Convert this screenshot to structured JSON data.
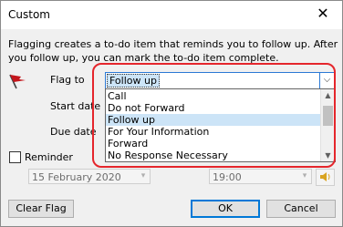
{
  "window": {
    "title": "Custom",
    "close_label": "✕"
  },
  "description": "Flagging creates a to-do item that reminds you to follow up. After you follow up, you can mark the to-do item complete.",
  "form": {
    "flag_to_label": "Flag to",
    "start_date_label": "Start date",
    "due_date_label": "Due date",
    "reminder_label": "Reminder",
    "reminder_checked": false
  },
  "flag_combo": {
    "selected_value": "Follow up",
    "arrow": "⌵",
    "options": [
      "Call",
      "Do not Forward",
      "Follow up",
      "For Your Information",
      "Forward",
      "No Response Necessary"
    ],
    "selected_index": 2
  },
  "reminder": {
    "date_value": "15 February 2020",
    "time_value": "19:00",
    "dropdown_arrow": "▾",
    "sound_icon": "speaker-icon"
  },
  "buttons": {
    "clear_flag": "Clear Flag",
    "ok": "OK",
    "cancel": "Cancel"
  },
  "colors": {
    "highlight_red": "#e5262c",
    "selection_blue": "#cce4f7",
    "focus_blue": "#2b79d5"
  }
}
